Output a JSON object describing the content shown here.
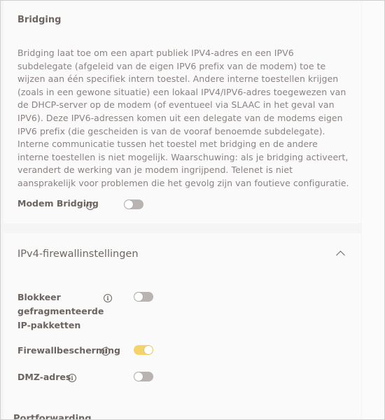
{
  "bridging": {
    "title": "Bridging",
    "description": "Bridging laat toe om een apart publiek IPV4-adres en een IPV6 subdelegate (afgeleid van de eigen IPV6 prefix van de modem) toe te wijzen aan één specifiek intern toestel. Andere interne toestellen krijgen (zoals in een gewone situatie) een lokaal IPV4/IPV6-adres toegewezen van de DHCP-server op de modem (of eventueel via SLAAC in het geval van IPV6). Deze IPV6-adressen komen uit een delegate van de modems eigen IPV6 prefix (die gescheiden is van de vooraf benoemde subdelegate). Interne communicatie tussen het toestel met bridging en de andere interne toestellen is niet mogelijk. Waarschuwing: als je bridging activeert, verandert de werking van je modem ingrijpend. Telenet is niet aansprakelijk voor problemen die het gevolg zijn van foutieve configuratie.",
    "modem_bridging_label": "Modem Bridging",
    "modem_bridging_enabled": false
  },
  "firewall": {
    "title": "IPv4-firewallinstellingen",
    "items": [
      {
        "label": "Blokkeer gefragmenteerde IP-pakketten",
        "enabled": false
      },
      {
        "label": "Firewallbescherming",
        "enabled": true
      },
      {
        "label": "DMZ-adres",
        "enabled": false
      }
    ]
  },
  "next_section": {
    "title": "Portforwarding"
  },
  "icons": {
    "info": "info-icon",
    "chevron": "chevron-up-icon"
  },
  "colors": {
    "toggle_on": "#f4d36a",
    "toggle_off": "#b9b4b2"
  }
}
